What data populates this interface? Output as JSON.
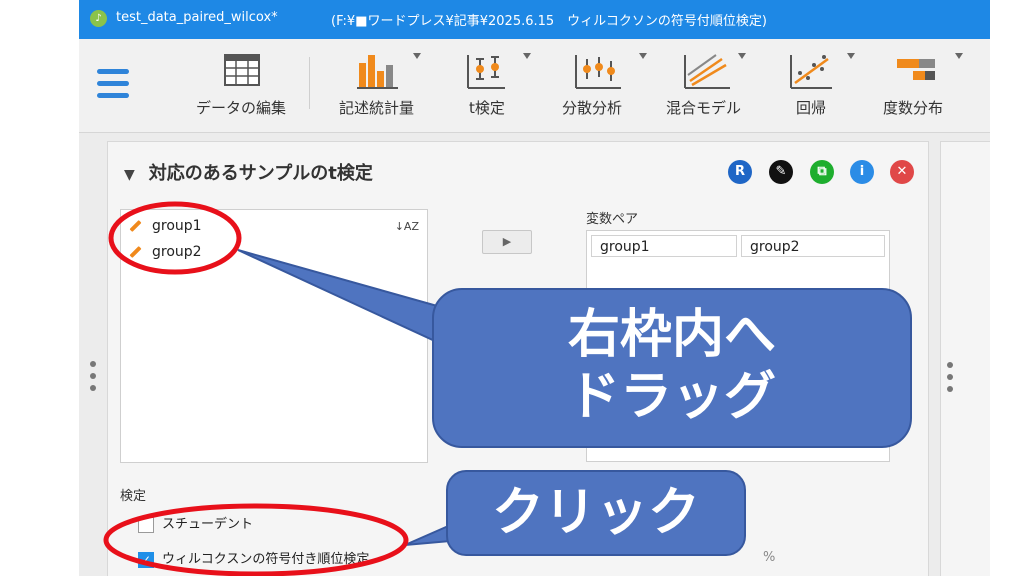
{
  "titlebar": {
    "title": "test_data_paired_wilcox*",
    "path": "(F:¥■ワードプレス¥記事¥2025.6.15　ウィルコクソンの符号付順位検定)"
  },
  "ribbon": {
    "items": [
      {
        "label": "データの編集",
        "icon": "spreadsheet-icon"
      },
      {
        "label": "記述統計量",
        "icon": "bar-chart-icon"
      },
      {
        "label": "t検定",
        "icon": "ttest-icon"
      },
      {
        "label": "分散分析",
        "icon": "anova-icon"
      },
      {
        "label": "混合モデル",
        "icon": "mixed-model-icon"
      },
      {
        "label": "回帰",
        "icon": "regression-icon"
      },
      {
        "label": "度数分布",
        "icon": "frequency-icon"
      }
    ]
  },
  "panel": {
    "title": "対応のあるサンプルのt検定",
    "header_icons": [
      {
        "name": "r-icon",
        "glyph": "R",
        "color": "#1f66c6"
      },
      {
        "name": "edit-icon",
        "glyph": "✎",
        "color": "#111111"
      },
      {
        "name": "copy-icon",
        "glyph": "⧉",
        "color": "#1eae2e"
      },
      {
        "name": "info-icon",
        "glyph": "i",
        "color": "#2b8ce6"
      },
      {
        "name": "close-icon",
        "glyph": "✕",
        "color": "#e04848"
      }
    ],
    "variables": [
      "group1",
      "group2"
    ],
    "sort_glyph": "↓AZ",
    "pair_label": "変数ペア",
    "pair": [
      "group1",
      "group2"
    ],
    "tests_label": "検定",
    "tests": [
      {
        "label": "スチューデント",
        "checked": false
      },
      {
        "label": "ウィルコクスンの符号付き順位検定",
        "checked": true
      }
    ],
    "pct_fragment": "%"
  },
  "annotations": {
    "drag_line1": "右枠内へ",
    "drag_line2": "ドラッグ",
    "click_text": "クリック",
    "color": "#e8101a"
  }
}
